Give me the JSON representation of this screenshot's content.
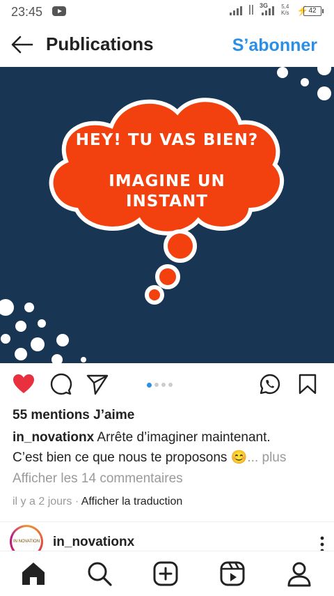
{
  "status_bar": {
    "time": "23:45",
    "network_type": "3G",
    "net_speed_value": "5,4",
    "net_speed_unit": "K/s",
    "battery": "42"
  },
  "header": {
    "title": "Publications",
    "subscribe_label": "S’abonner",
    "back_icon": "arrow-left-icon"
  },
  "post": {
    "image_line1": "HEY! TU VAS BIEN?",
    "image_line2a": "IMAGINE UN",
    "image_line2b": "INSTANT",
    "likes": "55 mentions J’aime",
    "author": "in_novationx",
    "caption_line1": "Arrête d’imaginer maintenant.",
    "caption_line2": "C’est bien ce que nous te proposons",
    "caption_emoji": "😊",
    "more_label": "... plus",
    "view_comments": "Afficher les 14 commentaires",
    "time_ago": "il y a 2 jours",
    "separator": " · ",
    "translate_label": "Afficher la traduction",
    "carousel_count": 4,
    "carousel_active": 1
  },
  "next_post": {
    "author": "in_novationx",
    "avatar_text": "IN NOVATION"
  },
  "colors": {
    "accent": "#2b8fe6",
    "like_red": "#e8303e",
    "image_bg": "#183553",
    "bubble_orange": "#f2410f"
  },
  "bottom_nav": [
    "home-icon",
    "search-icon",
    "add-post-icon",
    "reels-icon",
    "profile-icon"
  ]
}
